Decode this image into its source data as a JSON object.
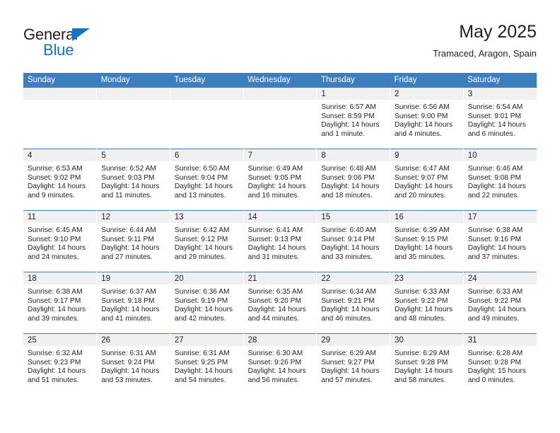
{
  "brand": {
    "logo_text_1": "General",
    "logo_text_2": "Blue",
    "logo_triangle_icon": "triangle-icon",
    "accent_color": "#1473c6"
  },
  "header": {
    "month_year": "May 2025",
    "location": "Tramaced, Aragon, Spain"
  },
  "calendar": {
    "header_color": "#3d7ebf",
    "daynum_bg": "#f0f0f0",
    "weekdays": [
      "Sunday",
      "Monday",
      "Tuesday",
      "Wednesday",
      "Thursday",
      "Friday",
      "Saturday"
    ],
    "weeks": [
      [
        {
          "day": "",
          "empty": true,
          "sunrise": "",
          "sunset": "",
          "daylight_line1": "",
          "daylight_line2": ""
        },
        {
          "day": "",
          "empty": true,
          "sunrise": "",
          "sunset": "",
          "daylight_line1": "",
          "daylight_line2": ""
        },
        {
          "day": "",
          "empty": true,
          "sunrise": "",
          "sunset": "",
          "daylight_line1": "",
          "daylight_line2": ""
        },
        {
          "day": "",
          "empty": true,
          "sunrise": "",
          "sunset": "",
          "daylight_line1": "",
          "daylight_line2": ""
        },
        {
          "day": "1",
          "empty": false,
          "sunrise": "Sunrise: 6:57 AM",
          "sunset": "Sunset: 8:59 PM",
          "daylight_line1": "Daylight: 14 hours",
          "daylight_line2": "and 1 minute."
        },
        {
          "day": "2",
          "empty": false,
          "sunrise": "Sunrise: 6:56 AM",
          "sunset": "Sunset: 9:00 PM",
          "daylight_line1": "Daylight: 14 hours",
          "daylight_line2": "and 4 minutes."
        },
        {
          "day": "3",
          "empty": false,
          "sunrise": "Sunrise: 6:54 AM",
          "sunset": "Sunset: 9:01 PM",
          "daylight_line1": "Daylight: 14 hours",
          "daylight_line2": "and 6 minutes."
        }
      ],
      [
        {
          "day": "4",
          "empty": false,
          "sunrise": "Sunrise: 6:53 AM",
          "sunset": "Sunset: 9:02 PM",
          "daylight_line1": "Daylight: 14 hours",
          "daylight_line2": "and 9 minutes."
        },
        {
          "day": "5",
          "empty": false,
          "sunrise": "Sunrise: 6:52 AM",
          "sunset": "Sunset: 9:03 PM",
          "daylight_line1": "Daylight: 14 hours",
          "daylight_line2": "and 11 minutes."
        },
        {
          "day": "6",
          "empty": false,
          "sunrise": "Sunrise: 6:50 AM",
          "sunset": "Sunset: 9:04 PM",
          "daylight_line1": "Daylight: 14 hours",
          "daylight_line2": "and 13 minutes."
        },
        {
          "day": "7",
          "empty": false,
          "sunrise": "Sunrise: 6:49 AM",
          "sunset": "Sunset: 9:05 PM",
          "daylight_line1": "Daylight: 14 hours",
          "daylight_line2": "and 16 minutes."
        },
        {
          "day": "8",
          "empty": false,
          "sunrise": "Sunrise: 6:48 AM",
          "sunset": "Sunset: 9:06 PM",
          "daylight_line1": "Daylight: 14 hours",
          "daylight_line2": "and 18 minutes."
        },
        {
          "day": "9",
          "empty": false,
          "sunrise": "Sunrise: 6:47 AM",
          "sunset": "Sunset: 9:07 PM",
          "daylight_line1": "Daylight: 14 hours",
          "daylight_line2": "and 20 minutes."
        },
        {
          "day": "10",
          "empty": false,
          "sunrise": "Sunrise: 6:46 AM",
          "sunset": "Sunset: 9:08 PM",
          "daylight_line1": "Daylight: 14 hours",
          "daylight_line2": "and 22 minutes."
        }
      ],
      [
        {
          "day": "11",
          "empty": false,
          "sunrise": "Sunrise: 6:45 AM",
          "sunset": "Sunset: 9:10 PM",
          "daylight_line1": "Daylight: 14 hours",
          "daylight_line2": "and 24 minutes."
        },
        {
          "day": "12",
          "empty": false,
          "sunrise": "Sunrise: 6:44 AM",
          "sunset": "Sunset: 9:11 PM",
          "daylight_line1": "Daylight: 14 hours",
          "daylight_line2": "and 27 minutes."
        },
        {
          "day": "13",
          "empty": false,
          "sunrise": "Sunrise: 6:42 AM",
          "sunset": "Sunset: 9:12 PM",
          "daylight_line1": "Daylight: 14 hours",
          "daylight_line2": "and 29 minutes."
        },
        {
          "day": "14",
          "empty": false,
          "sunrise": "Sunrise: 6:41 AM",
          "sunset": "Sunset: 9:13 PM",
          "daylight_line1": "Daylight: 14 hours",
          "daylight_line2": "and 31 minutes."
        },
        {
          "day": "15",
          "empty": false,
          "sunrise": "Sunrise: 6:40 AM",
          "sunset": "Sunset: 9:14 PM",
          "daylight_line1": "Daylight: 14 hours",
          "daylight_line2": "and 33 minutes."
        },
        {
          "day": "16",
          "empty": false,
          "sunrise": "Sunrise: 6:39 AM",
          "sunset": "Sunset: 9:15 PM",
          "daylight_line1": "Daylight: 14 hours",
          "daylight_line2": "and 35 minutes."
        },
        {
          "day": "17",
          "empty": false,
          "sunrise": "Sunrise: 6:38 AM",
          "sunset": "Sunset: 9:16 PM",
          "daylight_line1": "Daylight: 14 hours",
          "daylight_line2": "and 37 minutes."
        }
      ],
      [
        {
          "day": "18",
          "empty": false,
          "sunrise": "Sunrise: 6:38 AM",
          "sunset": "Sunset: 9:17 PM",
          "daylight_line1": "Daylight: 14 hours",
          "daylight_line2": "and 39 minutes."
        },
        {
          "day": "19",
          "empty": false,
          "sunrise": "Sunrise: 6:37 AM",
          "sunset": "Sunset: 9:18 PM",
          "daylight_line1": "Daylight: 14 hours",
          "daylight_line2": "and 41 minutes."
        },
        {
          "day": "20",
          "empty": false,
          "sunrise": "Sunrise: 6:36 AM",
          "sunset": "Sunset: 9:19 PM",
          "daylight_line1": "Daylight: 14 hours",
          "daylight_line2": "and 42 minutes."
        },
        {
          "day": "21",
          "empty": false,
          "sunrise": "Sunrise: 6:35 AM",
          "sunset": "Sunset: 9:20 PM",
          "daylight_line1": "Daylight: 14 hours",
          "daylight_line2": "and 44 minutes."
        },
        {
          "day": "22",
          "empty": false,
          "sunrise": "Sunrise: 6:34 AM",
          "sunset": "Sunset: 9:21 PM",
          "daylight_line1": "Daylight: 14 hours",
          "daylight_line2": "and 46 minutes."
        },
        {
          "day": "23",
          "empty": false,
          "sunrise": "Sunrise: 6:33 AM",
          "sunset": "Sunset: 9:22 PM",
          "daylight_line1": "Daylight: 14 hours",
          "daylight_line2": "and 48 minutes."
        },
        {
          "day": "24",
          "empty": false,
          "sunrise": "Sunrise: 6:33 AM",
          "sunset": "Sunset: 9:22 PM",
          "daylight_line1": "Daylight: 14 hours",
          "daylight_line2": "and 49 minutes."
        }
      ],
      [
        {
          "day": "25",
          "empty": false,
          "sunrise": "Sunrise: 6:32 AM",
          "sunset": "Sunset: 9:23 PM",
          "daylight_line1": "Daylight: 14 hours",
          "daylight_line2": "and 51 minutes."
        },
        {
          "day": "26",
          "empty": false,
          "sunrise": "Sunrise: 6:31 AM",
          "sunset": "Sunset: 9:24 PM",
          "daylight_line1": "Daylight: 14 hours",
          "daylight_line2": "and 53 minutes."
        },
        {
          "day": "27",
          "empty": false,
          "sunrise": "Sunrise: 6:31 AM",
          "sunset": "Sunset: 9:25 PM",
          "daylight_line1": "Daylight: 14 hours",
          "daylight_line2": "and 54 minutes."
        },
        {
          "day": "28",
          "empty": false,
          "sunrise": "Sunrise: 6:30 AM",
          "sunset": "Sunset: 9:26 PM",
          "daylight_line1": "Daylight: 14 hours",
          "daylight_line2": "and 56 minutes."
        },
        {
          "day": "29",
          "empty": false,
          "sunrise": "Sunrise: 6:29 AM",
          "sunset": "Sunset: 9:27 PM",
          "daylight_line1": "Daylight: 14 hours",
          "daylight_line2": "and 57 minutes."
        },
        {
          "day": "30",
          "empty": false,
          "sunrise": "Sunrise: 6:29 AM",
          "sunset": "Sunset: 9:28 PM",
          "daylight_line1": "Daylight: 14 hours",
          "daylight_line2": "and 58 minutes."
        },
        {
          "day": "31",
          "empty": false,
          "sunrise": "Sunrise: 6:28 AM",
          "sunset": "Sunset: 9:28 PM",
          "daylight_line1": "Daylight: 15 hours",
          "daylight_line2": "and 0 minutes."
        }
      ]
    ]
  }
}
